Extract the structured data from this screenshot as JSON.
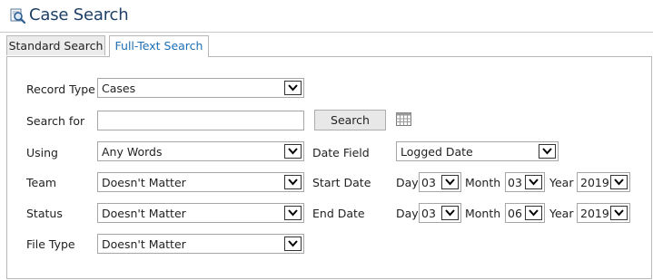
{
  "header": {
    "title": "Case Search",
    "icon": "search-icon"
  },
  "tabs": [
    {
      "label": "Standard Search",
      "active": false
    },
    {
      "label": "Full-Text Search",
      "active": true
    }
  ],
  "form": {
    "record_type": {
      "label": "Record Type",
      "value": "Cases"
    },
    "search_for": {
      "label": "Search for",
      "value": "",
      "button": "Search",
      "calendar_icon": "calendar-icon"
    },
    "using": {
      "label": "Using",
      "value": "Any Words"
    },
    "date_field": {
      "label": "Date Field",
      "value": "Logged Date"
    },
    "team": {
      "label": "Team",
      "value": "Doesn't Matter"
    },
    "status": {
      "label": "Status",
      "value": "Doesn't Matter"
    },
    "file_type": {
      "label": "File Type",
      "value": "Doesn't Matter"
    },
    "start_date": {
      "label": "Start Date",
      "day_label": "Day",
      "day": "03",
      "month_label": "Month",
      "month": "03",
      "year_label": "Year",
      "year": "2019"
    },
    "end_date": {
      "label": "End Date",
      "day_label": "Day",
      "day": "03",
      "month_label": "Month",
      "month": "06",
      "year_label": "Year",
      "year": "2019"
    }
  },
  "colors": {
    "title": "#1f3f64",
    "active_tab": "#1d6fb5",
    "border": "#b7b7b7"
  }
}
